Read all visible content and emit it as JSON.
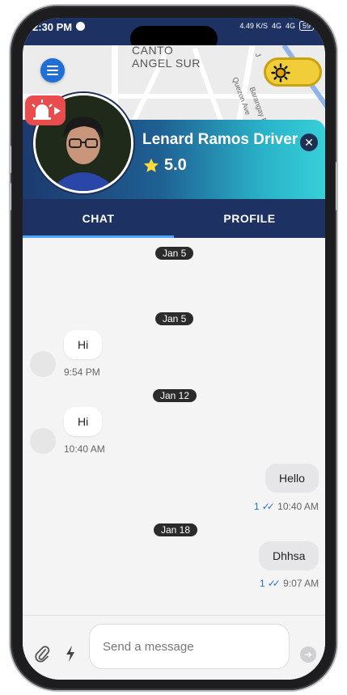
{
  "status_bar": {
    "time": "2:30 PM",
    "network_speed": "4.49 K/S",
    "signal_1": "4G",
    "signal_2": "4G",
    "battery": "59"
  },
  "map": {
    "labels": [
      "CANTO",
      "ANGEL SUR"
    ],
    "street_labels": [
      "Quezon Ave",
      "Barangay R",
      "J"
    ],
    "theme_toggle": "sun-icon"
  },
  "driver": {
    "name": "Lenard Ramos Driver",
    "rating": "5.0"
  },
  "tabs": [
    {
      "label": "CHAT",
      "active": true
    },
    {
      "label": "PROFILE",
      "active": false
    }
  ],
  "messages": {
    "dates": [
      "Jan 5",
      "Jan 5",
      "Jan 12",
      "Jan 18"
    ],
    "incoming": [
      {
        "text": "Hi",
        "time": "9:54 PM"
      },
      {
        "text": "Hi",
        "time": "10:40 AM"
      }
    ],
    "outgoing": [
      {
        "text": "Hello",
        "count": "1",
        "time": "10:40 AM"
      },
      {
        "text": "Dhhsa",
        "count": "1",
        "time": "9:07 AM"
      }
    ]
  },
  "composer": {
    "placeholder": "Send a message"
  },
  "colors": {
    "header": "#1d3263",
    "accent": "#4da4ff",
    "sos": "#e84c4c",
    "toggle": "#f2cd3a"
  }
}
